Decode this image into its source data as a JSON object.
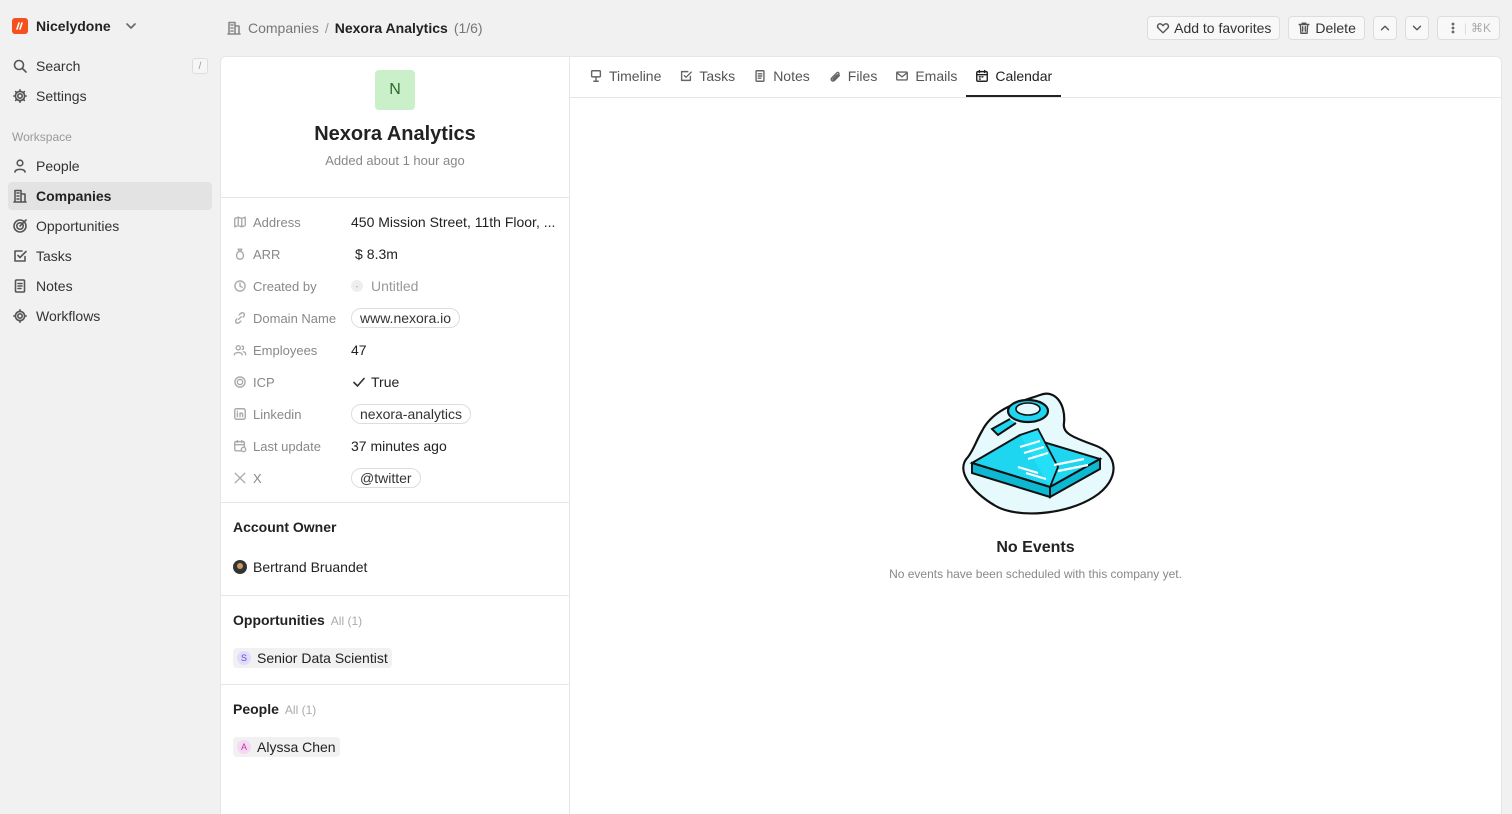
{
  "workspace": {
    "name": "Nicelydone"
  },
  "sidebar": {
    "search_label": "Search",
    "search_shortcut": "/",
    "settings_label": "Settings",
    "section_label": "Workspace",
    "items": [
      {
        "label": "People",
        "icon": "person-icon"
      },
      {
        "label": "Companies",
        "icon": "building-icon",
        "active": true
      },
      {
        "label": "Opportunities",
        "icon": "target-icon"
      },
      {
        "label": "Tasks",
        "icon": "checkbox-icon"
      },
      {
        "label": "Notes",
        "icon": "note-icon"
      },
      {
        "label": "Workflows",
        "icon": "gear-icon"
      }
    ]
  },
  "breadcrumb": {
    "parent": "Companies",
    "separator": "/",
    "current": "Nexora Analytics",
    "count": "(1/6)"
  },
  "toolbar": {
    "favorites_label": "Add to favorites",
    "delete_label": "Delete",
    "more_shortcut": "⌘K"
  },
  "company": {
    "initial": "N",
    "name": "Nexora Analytics",
    "added": "Added about 1 hour ago",
    "avatar_color": "#c9f0c8"
  },
  "fields": {
    "address": {
      "label": "Address",
      "value": "450 Mission Street, 11th Floor, ..."
    },
    "arr": {
      "label": "ARR",
      "currency": "$",
      "value": "8.3m"
    },
    "created_by": {
      "label": "Created by",
      "value": "Untitled"
    },
    "domain": {
      "label": "Domain Name",
      "value": "www.nexora.io"
    },
    "employees": {
      "label": "Employees",
      "value": "47"
    },
    "icp": {
      "label": "ICP",
      "value": "True"
    },
    "linkedin": {
      "label": "Linkedin",
      "value": "nexora-analytics"
    },
    "last_update": {
      "label": "Last update",
      "value": "37 minutes ago"
    },
    "x": {
      "label": "X",
      "value": "@twitter"
    }
  },
  "account_owner": {
    "title": "Account Owner",
    "name": "Bertrand Bruandet"
  },
  "opportunities": {
    "title": "Opportunities",
    "sub": "All (1)",
    "item_letter": "S",
    "item_label": "Senior Data Scientist",
    "item_color": "#e0dcfb"
  },
  "people": {
    "title": "People",
    "sub": "All (1)",
    "item_letter": "A",
    "item_label": "Alyssa Chen",
    "item_color": "#f6d8f3"
  },
  "tabs": [
    {
      "label": "Timeline",
      "icon": "timeline-icon"
    },
    {
      "label": "Tasks",
      "icon": "checkbox-icon"
    },
    {
      "label": "Notes",
      "icon": "note-icon"
    },
    {
      "label": "Files",
      "icon": "paperclip-icon"
    },
    {
      "label": "Emails",
      "icon": "mail-icon"
    },
    {
      "label": "Calendar",
      "icon": "calendar-icon",
      "active": true
    }
  ],
  "empty_state": {
    "title": "No Events",
    "subtitle": "No events have been scheduled with this company yet."
  },
  "colors": {
    "accent_logo": "#f4511e",
    "illustration": "#1fd6f0"
  }
}
